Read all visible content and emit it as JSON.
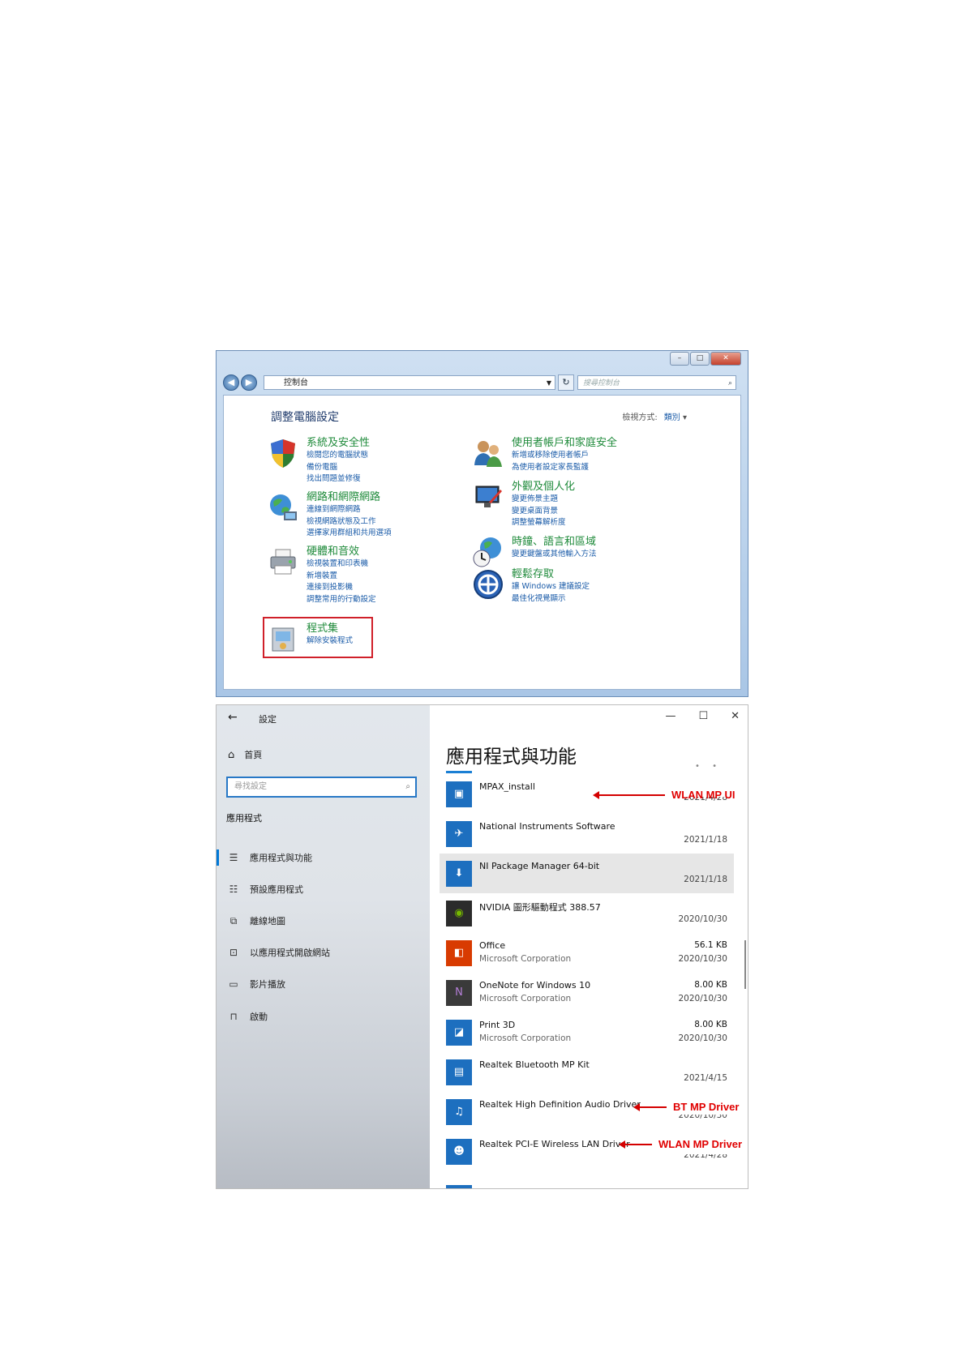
{
  "control_panel": {
    "breadcrumb": "控制台",
    "search_placeholder": "搜尋控制台",
    "heading": "調整電腦設定",
    "view_by_label": "檢視方式:",
    "view_by_value": "類別",
    "categories": [
      {
        "title": "系統及安全性",
        "links": [
          "檢閱您的電腦狀態",
          "備份電腦",
          "找出問題並修復"
        ],
        "icon": "shield-icon"
      },
      {
        "title": "網路和網際網路",
        "links": [
          "連線到網際網路",
          "檢視網路狀態及工作",
          "選擇家用群組和共用選項"
        ],
        "icon": "network-globe-icon"
      },
      {
        "title": "硬體和音效",
        "links": [
          "檢視裝置和印表機",
          "新增裝置",
          "連接到投影機",
          "調整常用的行動設定"
        ],
        "icon": "printer-icon"
      },
      {
        "title": "程式集",
        "links": [
          "解除安裝程式"
        ],
        "icon": "programs-icon"
      },
      {
        "title": "使用者帳戶和家庭安全",
        "links": [
          "新增或移除使用者帳戶",
          "為使用者設定家長監護"
        ],
        "icon": "users-icon"
      },
      {
        "title": "外觀及個人化",
        "links": [
          "變更佈景主題",
          "變更桌面背景",
          "調整螢幕解析度"
        ],
        "icon": "appearance-icon"
      },
      {
        "title": "時鐘、語言和區域",
        "links": [
          "變更鍵盤或其他輸入方法"
        ],
        "icon": "clock-globe-icon"
      },
      {
        "title": "輕鬆存取",
        "links": [
          "讓 Windows 建議設定",
          "最佳化視覺顯示"
        ],
        "icon": "ease-of-access-icon"
      }
    ]
  },
  "settings": {
    "window_title": "設定",
    "home_label": "首頁",
    "search_placeholder": "尋找設定",
    "group_label": "應用程式",
    "nav": [
      {
        "label": "應用程式與功能",
        "icon": "list-icon",
        "active": true
      },
      {
        "label": "預設應用程式",
        "icon": "default-apps-icon",
        "active": false
      },
      {
        "label": "離線地圖",
        "icon": "map-icon",
        "active": false
      },
      {
        "label": "以應用程式開啟網站",
        "icon": "open-website-icon",
        "active": false
      },
      {
        "label": "影片播放",
        "icon": "video-icon",
        "active": false
      },
      {
        "label": "啟動",
        "icon": "startup-icon",
        "active": false
      }
    ],
    "page_title": "應用程式與功能",
    "apps": [
      {
        "name": "MPAX_install",
        "publisher": "",
        "size": "",
        "date": "2021/4/28",
        "icon": "installer-icon",
        "icon_color": "#1d6fbf"
      },
      {
        "name": "National Instruments Software",
        "publisher": "",
        "size": "",
        "date": "2021/1/18",
        "icon": "ni-eagle-icon",
        "icon_color": "#1d6fbf"
      },
      {
        "name": "NI Package Manager 64-bit",
        "publisher": "",
        "size": "",
        "date": "2021/1/18",
        "icon": "download-arrow-icon",
        "icon_color": "#1d6fbf"
      },
      {
        "name": "NVIDIA 圖形驅動程式 388.57",
        "publisher": "",
        "size": "",
        "date": "2020/10/30",
        "icon": "nvidia-icon",
        "icon_color": "#2b2b2b"
      },
      {
        "name": "Office",
        "publisher": "Microsoft Corporation",
        "size": "56.1 KB",
        "date": "2020/10/30",
        "icon": "office-icon",
        "icon_color": "#d83b01"
      },
      {
        "name": "OneNote for Windows 10",
        "publisher": "Microsoft Corporation",
        "size": "8.00 KB",
        "date": "2020/10/30",
        "icon": "onenote-icon",
        "icon_color": "#5b2c8c"
      },
      {
        "name": "Print 3D",
        "publisher": "Microsoft Corporation",
        "size": "8.00 KB",
        "date": "2020/10/30",
        "icon": "print3d-icon",
        "icon_color": "#1d6fbf"
      },
      {
        "name": "Realtek Bluetooth MP Kit",
        "publisher": "",
        "size": "",
        "date": "2021/4/15",
        "icon": "bluetooth-kit-icon",
        "icon_color": "#1d6fbf"
      },
      {
        "name": "Realtek High Definition Audio Driver",
        "publisher": "",
        "size": "",
        "date": "2020/10/30",
        "icon": "audio-driver-icon",
        "icon_color": "#1d6fbf"
      },
      {
        "name": "Realtek PCI-E Wireless LAN Driver",
        "publisher": "",
        "size": "",
        "date": "2021/4/28",
        "icon": "wlan-driver-icon",
        "icon_color": "#1d6fbf"
      }
    ]
  },
  "annotations": [
    {
      "label": "WLAN MP UI",
      "target": "MPAX_install",
      "color": "#e00000"
    },
    {
      "label": "BT MP Driver",
      "target": "Realtek High Definition Audio Driver",
      "color": "#e00000"
    },
    {
      "label": "WLAN MP Driver",
      "target": "Realtek PCI-E Wireless LAN Driver",
      "color": "#e00000"
    }
  ]
}
